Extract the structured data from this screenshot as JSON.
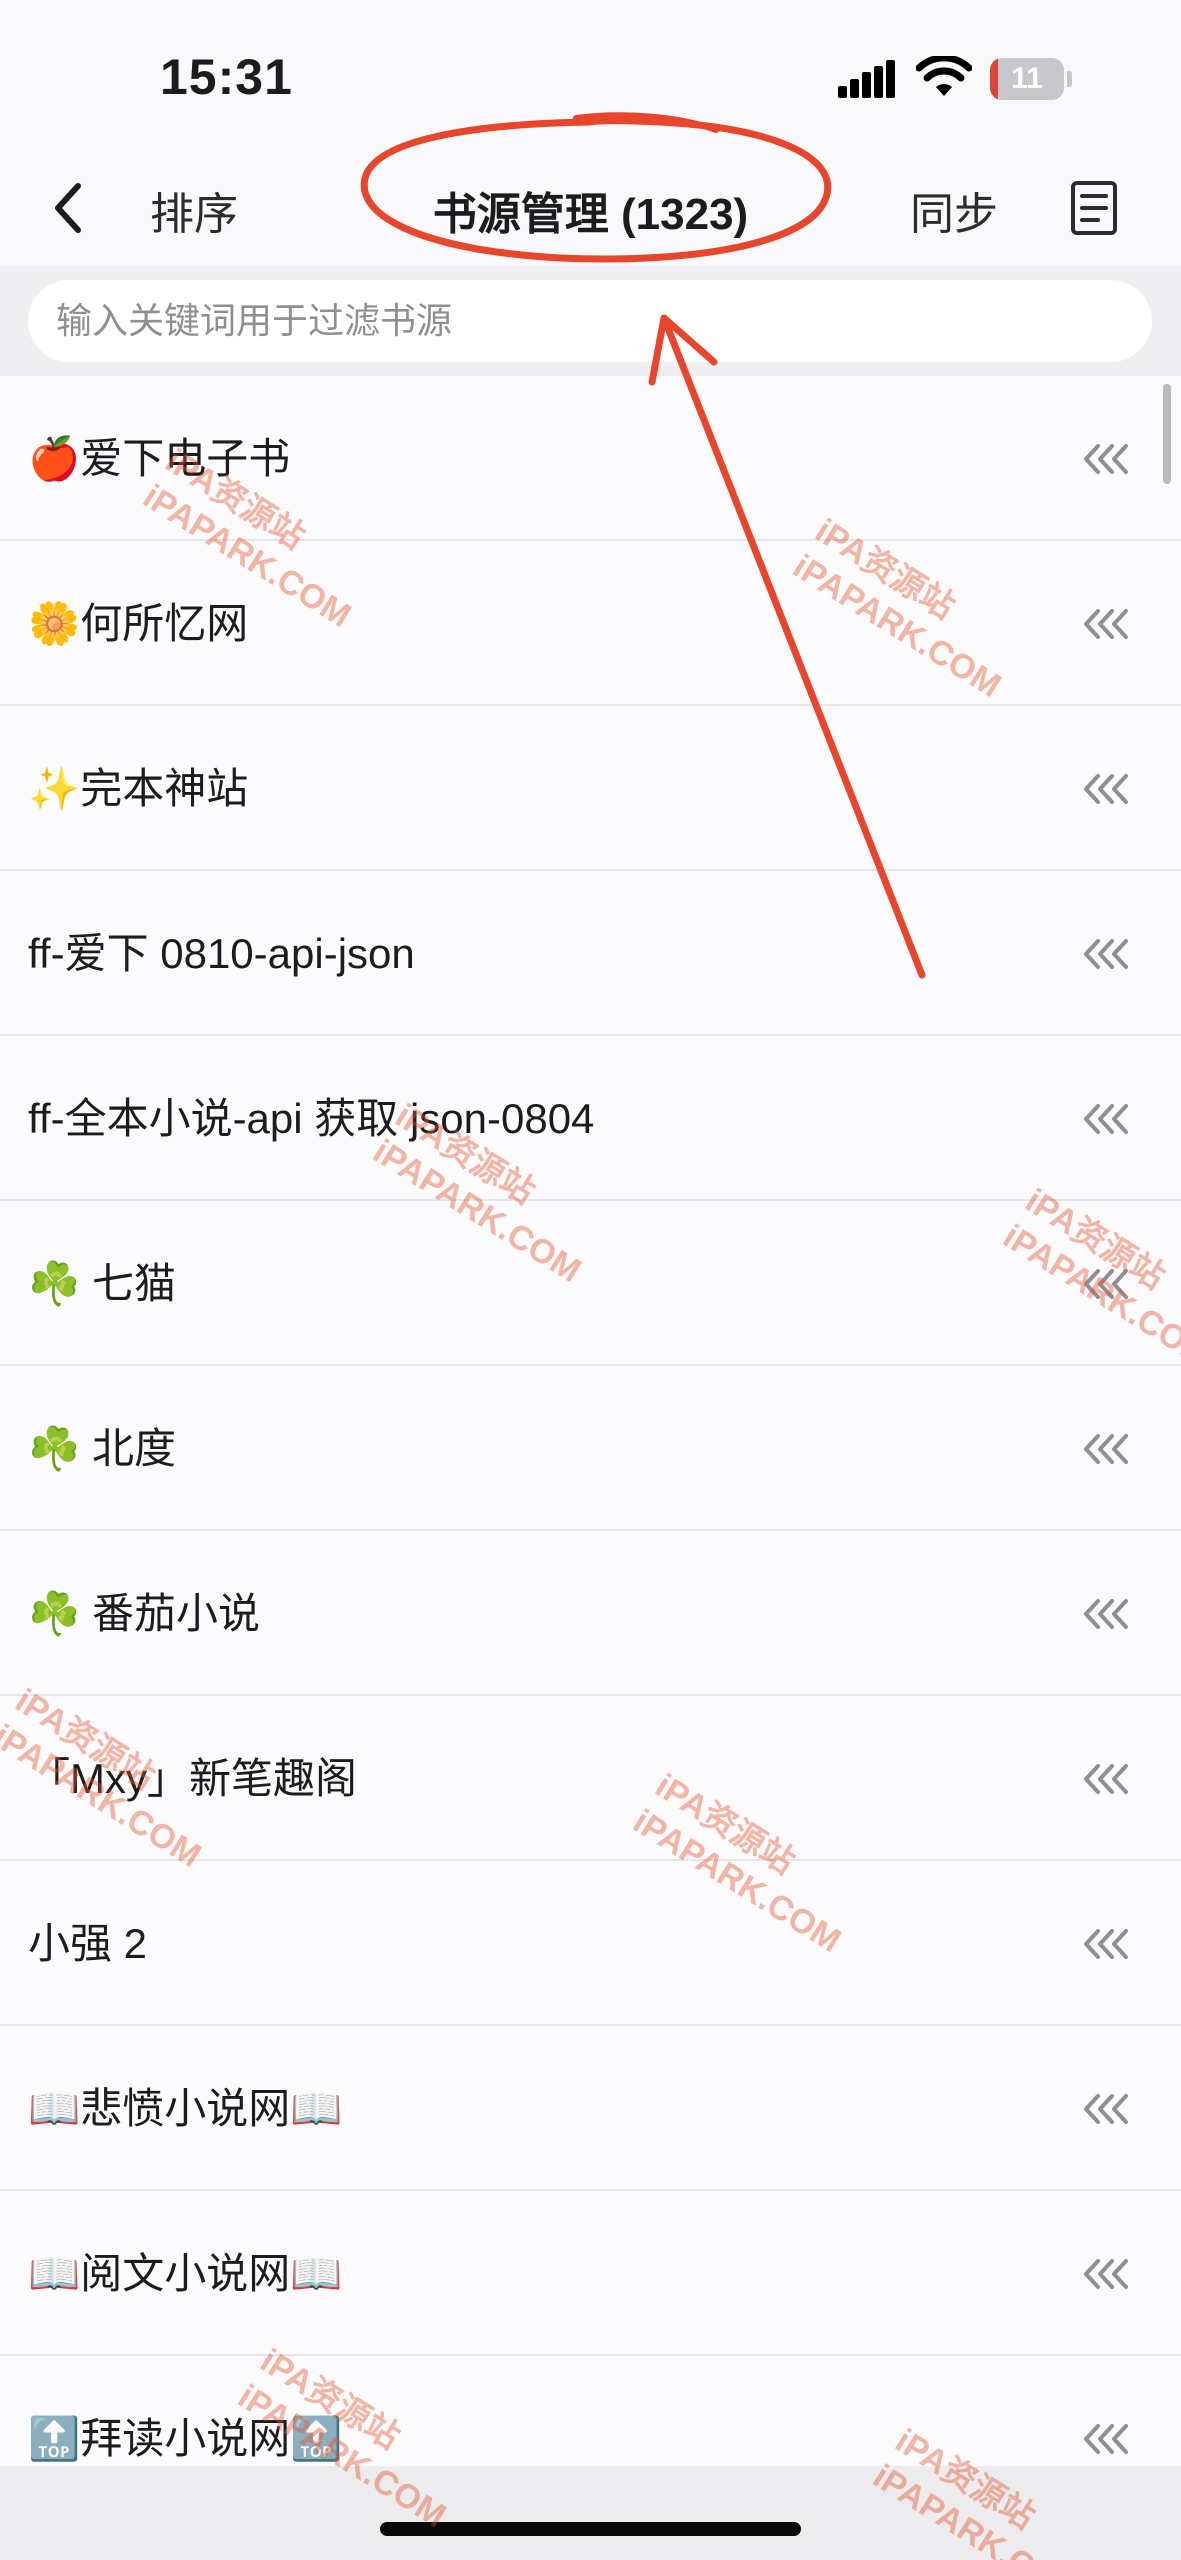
{
  "status_bar": {
    "time": "15:31",
    "battery_level": "11",
    "battery_fraction": 0.11,
    "battery_color": "#e0433a"
  },
  "nav": {
    "back_icon": "chevron-left-icon",
    "sort_label": "排序",
    "title": "书源管理 (1323)",
    "sync_label": "同步",
    "doc_icon": "document-list-icon"
  },
  "search": {
    "placeholder": "输入关键词用于过滤书源",
    "value": ""
  },
  "sources": [
    {
      "label": "🍎爱下电子书"
    },
    {
      "label": "🌼何所忆网"
    },
    {
      "label": "✨完本神站"
    },
    {
      "label": "ff-爱下 0810-api-json"
    },
    {
      "label": "ff-全本小说-api 获取 json-0804"
    },
    {
      "label": "☘️ 七猫"
    },
    {
      "label": "☘️ 北度"
    },
    {
      "label": "☘️ 番茄小说"
    },
    {
      "label": "「Mxy」新笔趣阁"
    },
    {
      "label": "小强 2"
    },
    {
      "label": "📖悲愤小说网📖"
    },
    {
      "label": "📖阅文小说网📖"
    },
    {
      "label": "🔝拜读小说网🔝"
    }
  ],
  "watermark": {
    "line1": "iPA资源站",
    "line2": "iPAPARK.COM"
  },
  "annotation_color": "#e8462c"
}
